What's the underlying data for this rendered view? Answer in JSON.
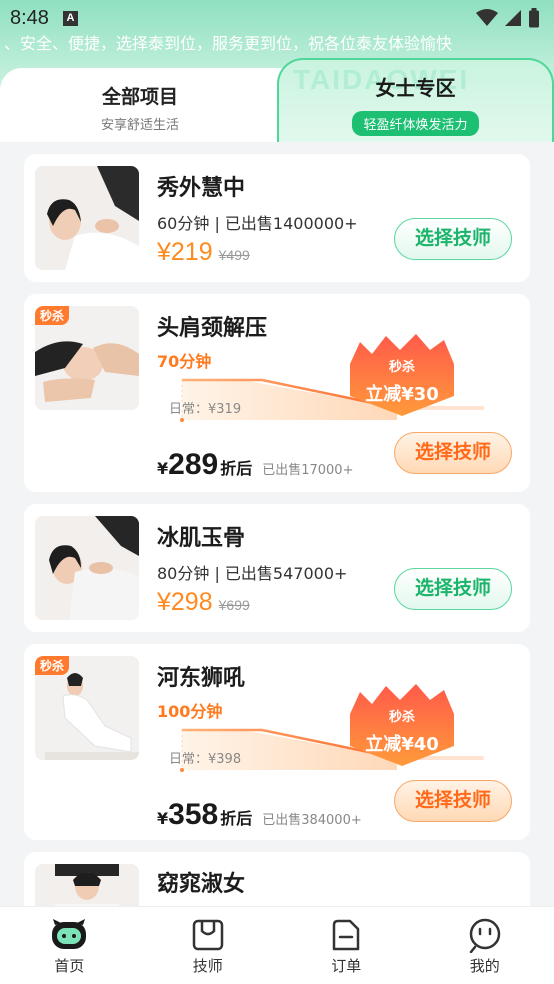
{
  "status_bar": {
    "time": "8:48",
    "notification_letter": "A"
  },
  "marquee_text": "、安全、便捷，选择泰到位，服务更到位，祝各位泰友体验愉快",
  "tabs": {
    "all": {
      "title": "全部项目",
      "subtitle": "安享舒适生活"
    },
    "women": {
      "watermark": "TAIDAOWEI",
      "title": "女士专区",
      "subtitle": "轻盈纤体焕发活力"
    }
  },
  "colors": {
    "accent_green": "#1dbf73",
    "accent_orange": "#ff7a1e"
  },
  "cards": [
    {
      "title": "秀外慧中",
      "meta": "60分钟 | 已出售1400000+",
      "price": "¥219",
      "price_old": "¥499",
      "button": "选择技师"
    },
    {
      "tag": "秒杀",
      "title": "头肩颈解压",
      "duration": "70分钟",
      "regular": "日常：¥319",
      "flash_label": "秒杀",
      "flash_discount": "立减¥30",
      "final_yen": "¥",
      "final_price": "289",
      "final_suffix": "折后",
      "sold": "已出售17000+",
      "button": "选择技师"
    },
    {
      "title": "冰肌玉骨",
      "meta": "80分钟 | 已出售547000+",
      "price": "¥298",
      "price_old": "¥699",
      "button": "选择技师"
    },
    {
      "tag": "秒杀",
      "title": "河东狮吼",
      "duration": "100分钟",
      "regular": "日常：¥398",
      "flash_label": "秒杀",
      "flash_discount": "立减¥40",
      "final_yen": "¥",
      "final_price": "358",
      "final_suffix": "折后",
      "sold": "已出售384000+",
      "button": "选择技师"
    },
    {
      "title": "窈窕淑女"
    }
  ],
  "tabbar": [
    {
      "label": "首页",
      "icon": "home-mascot-icon"
    },
    {
      "label": "技师",
      "icon": "technician-icon"
    },
    {
      "label": "订单",
      "icon": "order-icon"
    },
    {
      "label": "我的",
      "icon": "profile-icon"
    }
  ]
}
